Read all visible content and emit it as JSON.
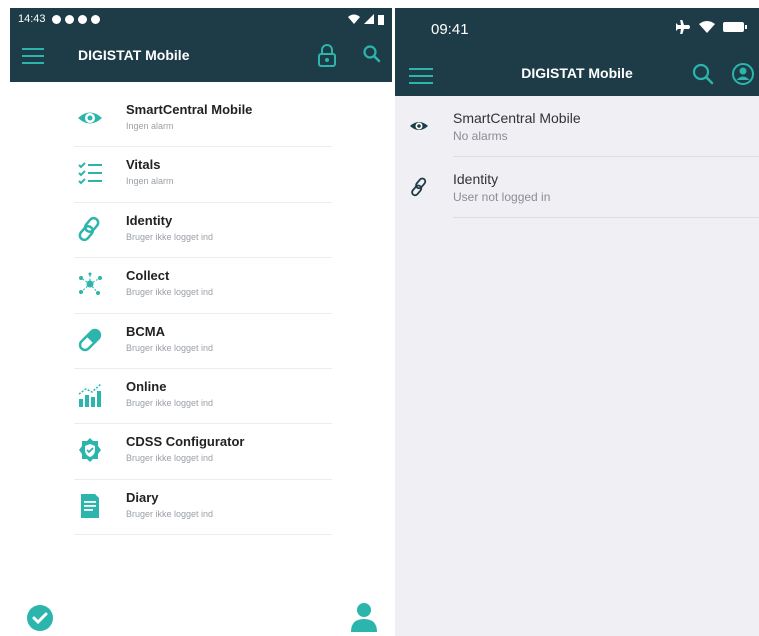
{
  "colors": {
    "accent": "#2cb5ac",
    "bar": "#1e3c47"
  },
  "android": {
    "status_time": "14:43",
    "title": "DIGISTAT Mobile",
    "items": [
      {
        "icon": "eye-icon",
        "label": "SmartCentral Mobile",
        "sub": "Ingen alarm"
      },
      {
        "icon": "checklist-icon",
        "label": "Vitals",
        "sub": "Ingen alarm"
      },
      {
        "icon": "link-icon",
        "label": "Identity",
        "sub": "Bruger ikke logget ind"
      },
      {
        "icon": "network-icon",
        "label": "Collect",
        "sub": "Bruger ikke logget ind"
      },
      {
        "icon": "pill-icon",
        "label": "BCMA",
        "sub": "Bruger ikke logget ind"
      },
      {
        "icon": "bar-chart-icon",
        "label": "Online",
        "sub": "Bruger ikke logget ind"
      },
      {
        "icon": "gear-shield-icon",
        "label": "CDSS Configurator",
        "sub": "Bruger ikke logget ind"
      },
      {
        "icon": "document-icon",
        "label": "Diary",
        "sub": "Bruger ikke logget ind"
      }
    ]
  },
  "ios": {
    "status_time": "09:41",
    "title": "DIGISTAT Mobile",
    "items": [
      {
        "icon": "eye-icon",
        "label": "SmartCentral Mobile",
        "sub": "No alarms"
      },
      {
        "icon": "link-icon",
        "label": "Identity",
        "sub": "User not logged in"
      }
    ]
  }
}
